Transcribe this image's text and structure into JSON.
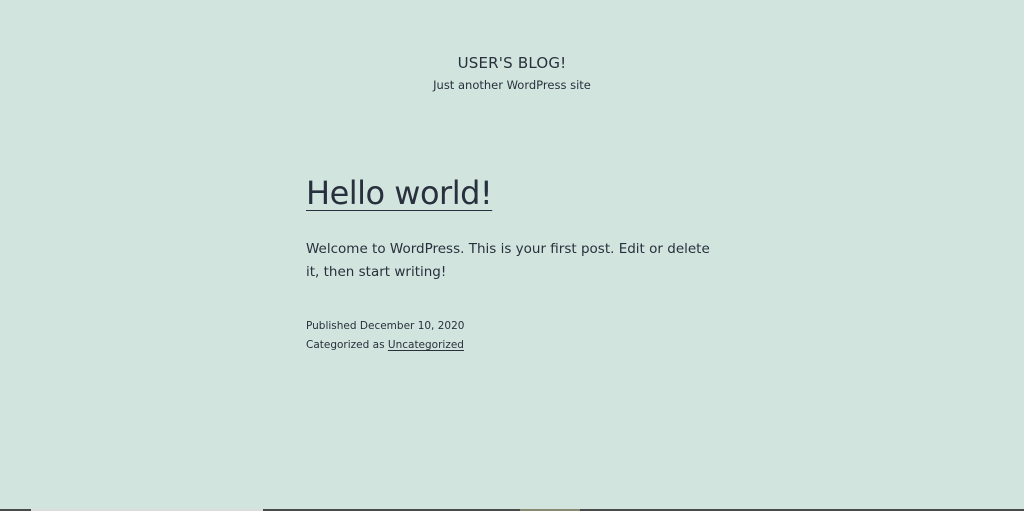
{
  "site": {
    "title": "USER'S BLOG!",
    "description": "Just another WordPress site"
  },
  "post": {
    "title": "Hello world!",
    "content": "Welcome to WordPress. This is your first post. Edit or delete it, then start writing!",
    "published_label": "Published",
    "published_date": "December 10, 2020",
    "categorized_label": "Categorized as",
    "category": "Uncategorized"
  },
  "colors": {
    "background": "#d1e4dd",
    "text": "#28303d"
  }
}
